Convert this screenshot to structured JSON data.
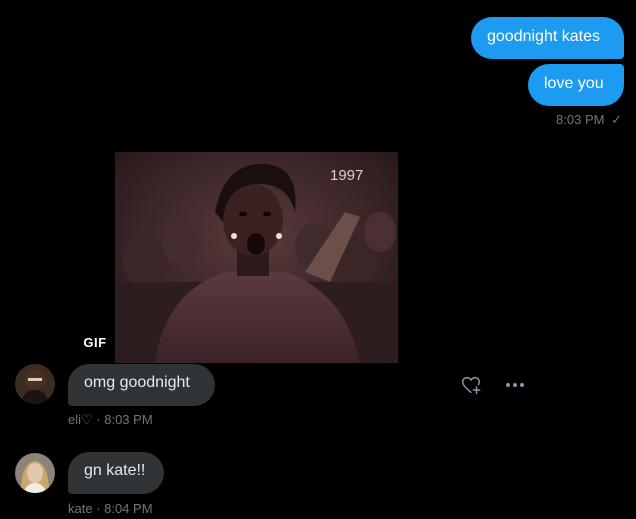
{
  "outgoing": {
    "messages": [
      {
        "text": "goodnight kates"
      },
      {
        "text": "love you"
      }
    ],
    "timestamp": "8:03 PM",
    "read_mark": "✓"
  },
  "gif": {
    "badge": "GIF",
    "overlay_year": "1997"
  },
  "incoming": [
    {
      "text": "omg goodnight",
      "sender": "eli♡",
      "time": "8:03 PM"
    },
    {
      "text": "gn kate!!",
      "sender": "kate",
      "time": "8:04 PM"
    }
  ],
  "meta_separator": " · ",
  "icons": {
    "react": "heart-plus-icon",
    "more": "more-horizontal-icon"
  },
  "colors": {
    "outgoing_bubble": "#1d9bf0",
    "incoming_bubble": "#2f3336",
    "meta_text": "#71767b",
    "background": "#000000"
  }
}
